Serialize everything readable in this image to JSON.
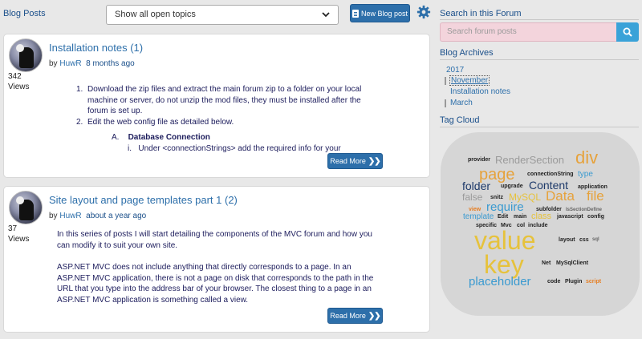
{
  "header": {
    "title": "Blog Posts",
    "filter_value": "Show all open topics",
    "new_post_label": "New Blog post"
  },
  "posts": [
    {
      "title": "Installation notes",
      "replies": "(1)",
      "views_count": "342",
      "views_label": "Views",
      "by": "by",
      "author": "HuwR",
      "when": "8 months ago",
      "steps": [
        {
          "n": "1.",
          "text": "Download the zip files and extract the main forum zip to a folder on your local machine or server, do not unzip the mod files, they must be installed after the forum is set up."
        },
        {
          "n": "2.",
          "text": "Edit the web config file as detailed below."
        }
      ],
      "sub_a_marker": "A.",
      "sub_a_text": "Database Connection",
      "sub_i_marker": "i.",
      "sub_i_text": "Under <connectionStrings> add the required info for your",
      "read_more": "Read More"
    },
    {
      "title": "Site layout and page templates part 1",
      "replies": "(2)",
      "views_count": "37",
      "views_label": "Views",
      "by": "by",
      "author": "HuwR",
      "when": "about a year ago",
      "para1": "In this series of posts I will start detailing the components of the MVC forum and how you can modify it to suit your own site.",
      "para2": "ASP.NET MVC does not include anything that directly corresponds to a page. In an ASP.NET MVC application, there is not a page on disk that corresponds to the path in the URL that you type into the address bar of your browser. The closest thing to a page in an ASP.NET MVC application is something called a view.",
      "read_more": "Read More"
    }
  ],
  "sidebar": {
    "search_heading": "Search in this Forum",
    "search_placeholder": "Search forum posts",
    "archives_heading": "Blog Archives",
    "archive_year": "2017",
    "archive_month_1": "November",
    "archive_post": "Installation notes",
    "archive_month_2": "March",
    "tag_cloud_heading": "Tag Cloud"
  },
  "tag_cloud": [
    {
      "text": "provider",
      "color": "#222222"
    },
    {
      "text": "RenderSection",
      "color": "#9a9a9a"
    },
    {
      "text": "div",
      "color": "#e6a23c"
    },
    {
      "text": "page",
      "color": "#e6a23c"
    },
    {
      "text": "connectionString",
      "color": "#222222"
    },
    {
      "text": "type",
      "color": "#3a9ad0"
    },
    {
      "text": "folder",
      "color": "#1e3a6a"
    },
    {
      "text": "upgrade",
      "color": "#222222"
    },
    {
      "text": "Content",
      "color": "#1e3a6a"
    },
    {
      "text": "application",
      "color": "#222222"
    },
    {
      "text": "false",
      "color": "#9a9a9a"
    },
    {
      "text": "snitz",
      "color": "#222222"
    },
    {
      "text": "MySQL",
      "color": "#e6c23c"
    },
    {
      "text": "Data",
      "color": "#e6a23c"
    },
    {
      "text": "file",
      "color": "#e6a23c"
    },
    {
      "text": "view",
      "color": "#e67e22"
    },
    {
      "text": "require",
      "color": "#3a9ad0"
    },
    {
      "text": "subfolder",
      "color": "#222222"
    },
    {
      "text": "IsSectionDefine",
      "color": "#666666"
    },
    {
      "text": "template",
      "color": "#3a9ad0"
    },
    {
      "text": "Edit",
      "color": "#222222"
    },
    {
      "text": "main",
      "color": "#222222"
    },
    {
      "text": "class",
      "color": "#e6c23c"
    },
    {
      "text": "javascript",
      "color": "#222222"
    },
    {
      "text": "config",
      "color": "#222222"
    },
    {
      "text": "specific",
      "color": "#222222"
    },
    {
      "text": "Mvc",
      "color": "#222222"
    },
    {
      "text": "col",
      "color": "#222222"
    },
    {
      "text": "include",
      "color": "#222222"
    },
    {
      "text": "value",
      "color": "#e6c23c"
    },
    {
      "text": "layout",
      "color": "#222222"
    },
    {
      "text": "css",
      "color": "#222222"
    },
    {
      "text": "sql",
      "color": "#666666"
    },
    {
      "text": "key",
      "color": "#e6c23c"
    },
    {
      "text": "Net",
      "color": "#222222"
    },
    {
      "text": "MySqlClient",
      "color": "#222222"
    },
    {
      "text": "placeholder",
      "color": "#3a9ad0"
    },
    {
      "text": "code",
      "color": "#222222"
    },
    {
      "text": "Plugin",
      "color": "#222222"
    },
    {
      "text": "script",
      "color": "#e67e22"
    }
  ]
}
